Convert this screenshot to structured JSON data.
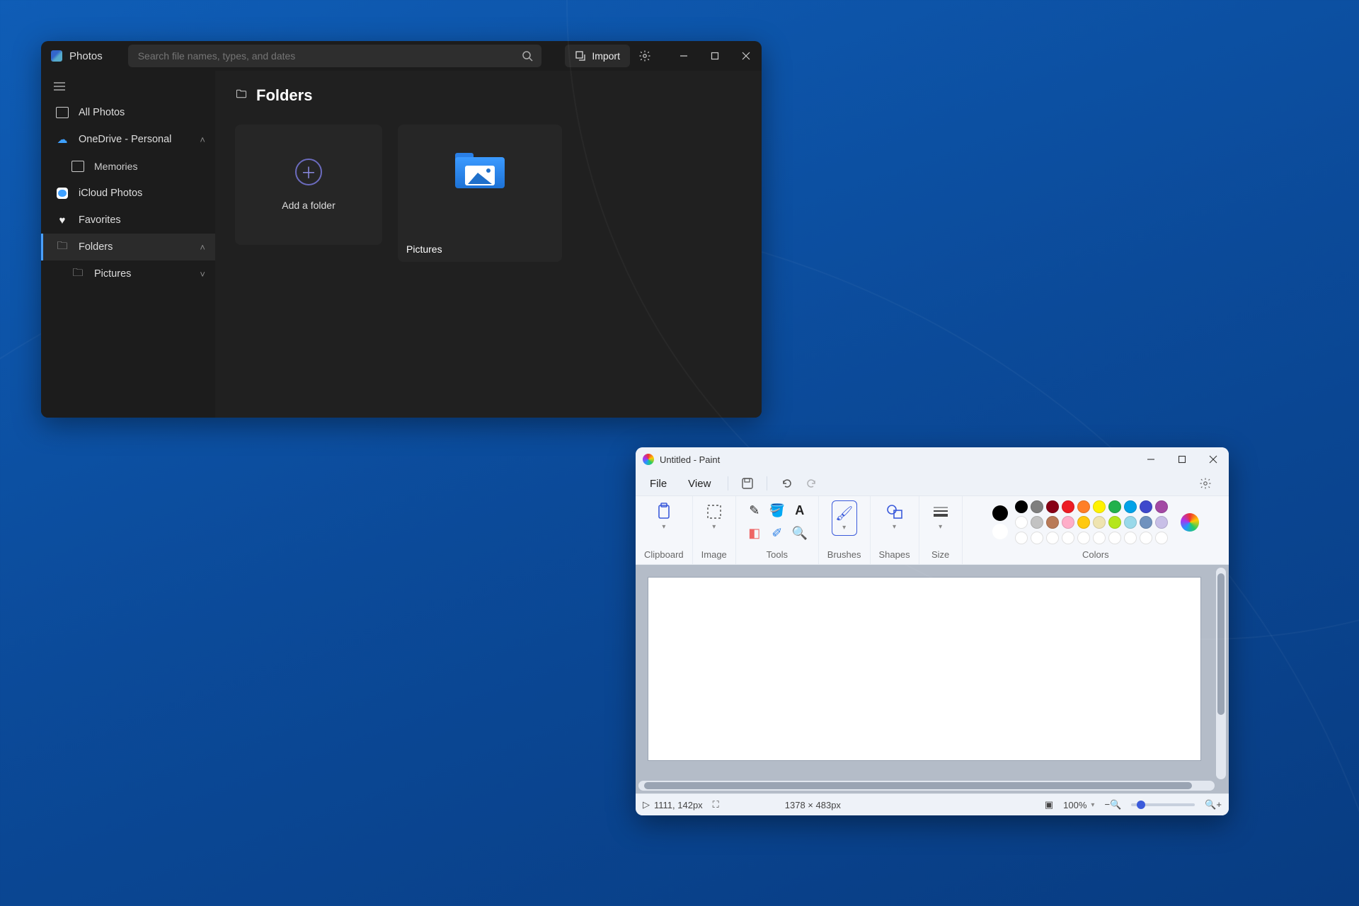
{
  "photos": {
    "title": "Photos",
    "search_placeholder": "Search file names, types, and dates",
    "import_label": "Import",
    "sidebar": {
      "all_photos": "All Photos",
      "onedrive": "OneDrive - Personal",
      "memories": "Memories",
      "icloud": "iCloud Photos",
      "favorites": "Favorites",
      "folders": "Folders",
      "pictures": "Pictures"
    },
    "main": {
      "heading": "Folders",
      "add_folder": "Add a folder",
      "pictures": "Pictures"
    }
  },
  "paint": {
    "title": "Untitled - Paint",
    "menus": {
      "file": "File",
      "view": "View"
    },
    "groups": {
      "clipboard": "Clipboard",
      "image": "Image",
      "tools": "Tools",
      "brushes": "Brushes",
      "shapes": "Shapes",
      "size": "Size",
      "colors": "Colors"
    },
    "palette_row1": [
      "#000000",
      "#7f7f7f",
      "#880015",
      "#ed1c24",
      "#ff7f27",
      "#fff200",
      "#22b14c",
      "#00a2e8",
      "#3f48cc",
      "#a349a4"
    ],
    "palette_row2": [
      "#ffffff",
      "#c3c3c3",
      "#b97a57",
      "#ffaec9",
      "#ffc90e",
      "#efe4b0",
      "#b5e61d",
      "#99d9ea",
      "#7092be",
      "#c8bfe7"
    ],
    "color1": "#000000",
    "color2": "#ffffff",
    "status": {
      "cursor": "1111, 142px",
      "size": "1378 × 483px",
      "zoom": "100%"
    }
  }
}
